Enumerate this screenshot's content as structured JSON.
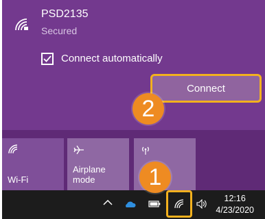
{
  "network": {
    "name": "PSD2135",
    "status": "Secured",
    "auto_connect_label": "Connect automatically",
    "auto_connect_checked": true,
    "connect_label": "Connect"
  },
  "quick_actions": [
    {
      "label": "Wi-Fi",
      "icon": "wifi-icon",
      "active": true
    },
    {
      "label": "Airplane mode",
      "icon": "airplane-icon",
      "active": false
    },
    {
      "label": "",
      "icon": "mobile-hotspot-icon",
      "active": false
    }
  ],
  "callouts": {
    "step1": "1",
    "step2": "2"
  },
  "taskbar": {
    "time": "12:16",
    "date": "4/23/2020",
    "tray_icons": [
      "chevron-up-icon",
      "onedrive-cloud-icon",
      "battery-icon",
      "wifi-icon",
      "volume-icon"
    ]
  },
  "colors": {
    "panel": "#5f2a76",
    "network_card": "#73398e",
    "highlight": "#f3b11e",
    "callout": "#ee8b22",
    "taskbar": "#1c1c1c"
  }
}
